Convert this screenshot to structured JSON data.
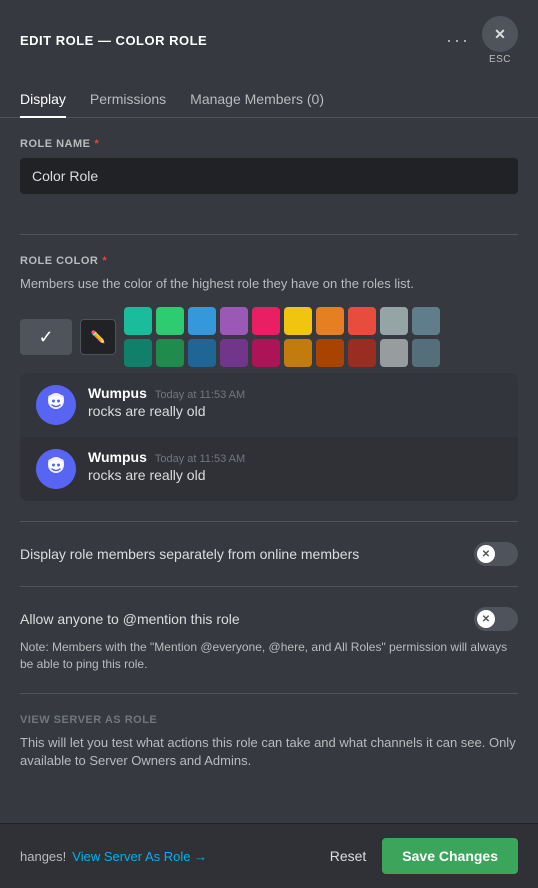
{
  "header": {
    "title": "EDIT ROLE — COLOR ROLE",
    "esc_label": "ESC"
  },
  "tabs": [
    {
      "id": "display",
      "label": "Display",
      "active": true
    },
    {
      "id": "permissions",
      "label": "Permissions",
      "active": false
    },
    {
      "id": "manage-members",
      "label": "Manage Members (0)",
      "active": false
    }
  ],
  "role_name_section": {
    "label": "ROLE NAME",
    "required": "*",
    "value": "Color Role",
    "placeholder": "Color Role"
  },
  "role_color_section": {
    "label": "ROLE COLOR",
    "required": "*",
    "description": "Members use the color of the highest role they have on the roles list.",
    "colors_row1": [
      "#1abc9c",
      "#2ecc71",
      "#3498db",
      "#9b59b6",
      "#e91e63",
      "#f1c40f",
      "#e67e22",
      "#e74c3c",
      "#95a5a6",
      "#607d8b"
    ],
    "colors_row2": [
      "#11806a",
      "#1f8b4c",
      "#206694",
      "#71368a",
      "#ad1457",
      "#c27c0e",
      "#a84300",
      "#992d22",
      "#979c9f",
      "#546e7a"
    ]
  },
  "preview": {
    "author": "Wumpus",
    "time1": "Today at 11:53 AM",
    "time2": "Today at 11:53 AM",
    "message": "rocks are really old"
  },
  "display_separate": {
    "label": "Display role members separately from online members",
    "enabled": false
  },
  "allow_mention": {
    "label": "Allow anyone to @mention this role",
    "enabled": false,
    "note": "Note: Members with the \"Mention @everyone, @here, and All Roles\" permission will always be able to ping this role."
  },
  "view_server": {
    "section_label": "VIEW SERVER AS ROLE",
    "description": "This will let you test what actions this role can take and what channels it can see. Only available to Server Owners and Admins.",
    "link_label": "View Server As Role →"
  },
  "footer": {
    "hint": "hanges!",
    "reset_label": "Reset",
    "save_label": "Save Changes"
  }
}
